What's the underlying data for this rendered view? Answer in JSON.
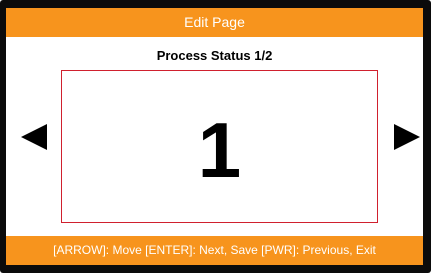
{
  "header": {
    "title": "Edit Page"
  },
  "main": {
    "subtitle": "Process Status 1/2",
    "value": "1",
    "prev_icon": "left-triangle-arrow-icon",
    "next_icon": "right-triangle-arrow-icon"
  },
  "footer": {
    "hint": "[ARROW]: Move [ENTER]:  Next, Save [PWR]: Previous, Exit"
  },
  "colors": {
    "accent": "#f7941d",
    "box_border": "#d0202e",
    "frame": "#0b0b0b",
    "text": "#000000"
  }
}
